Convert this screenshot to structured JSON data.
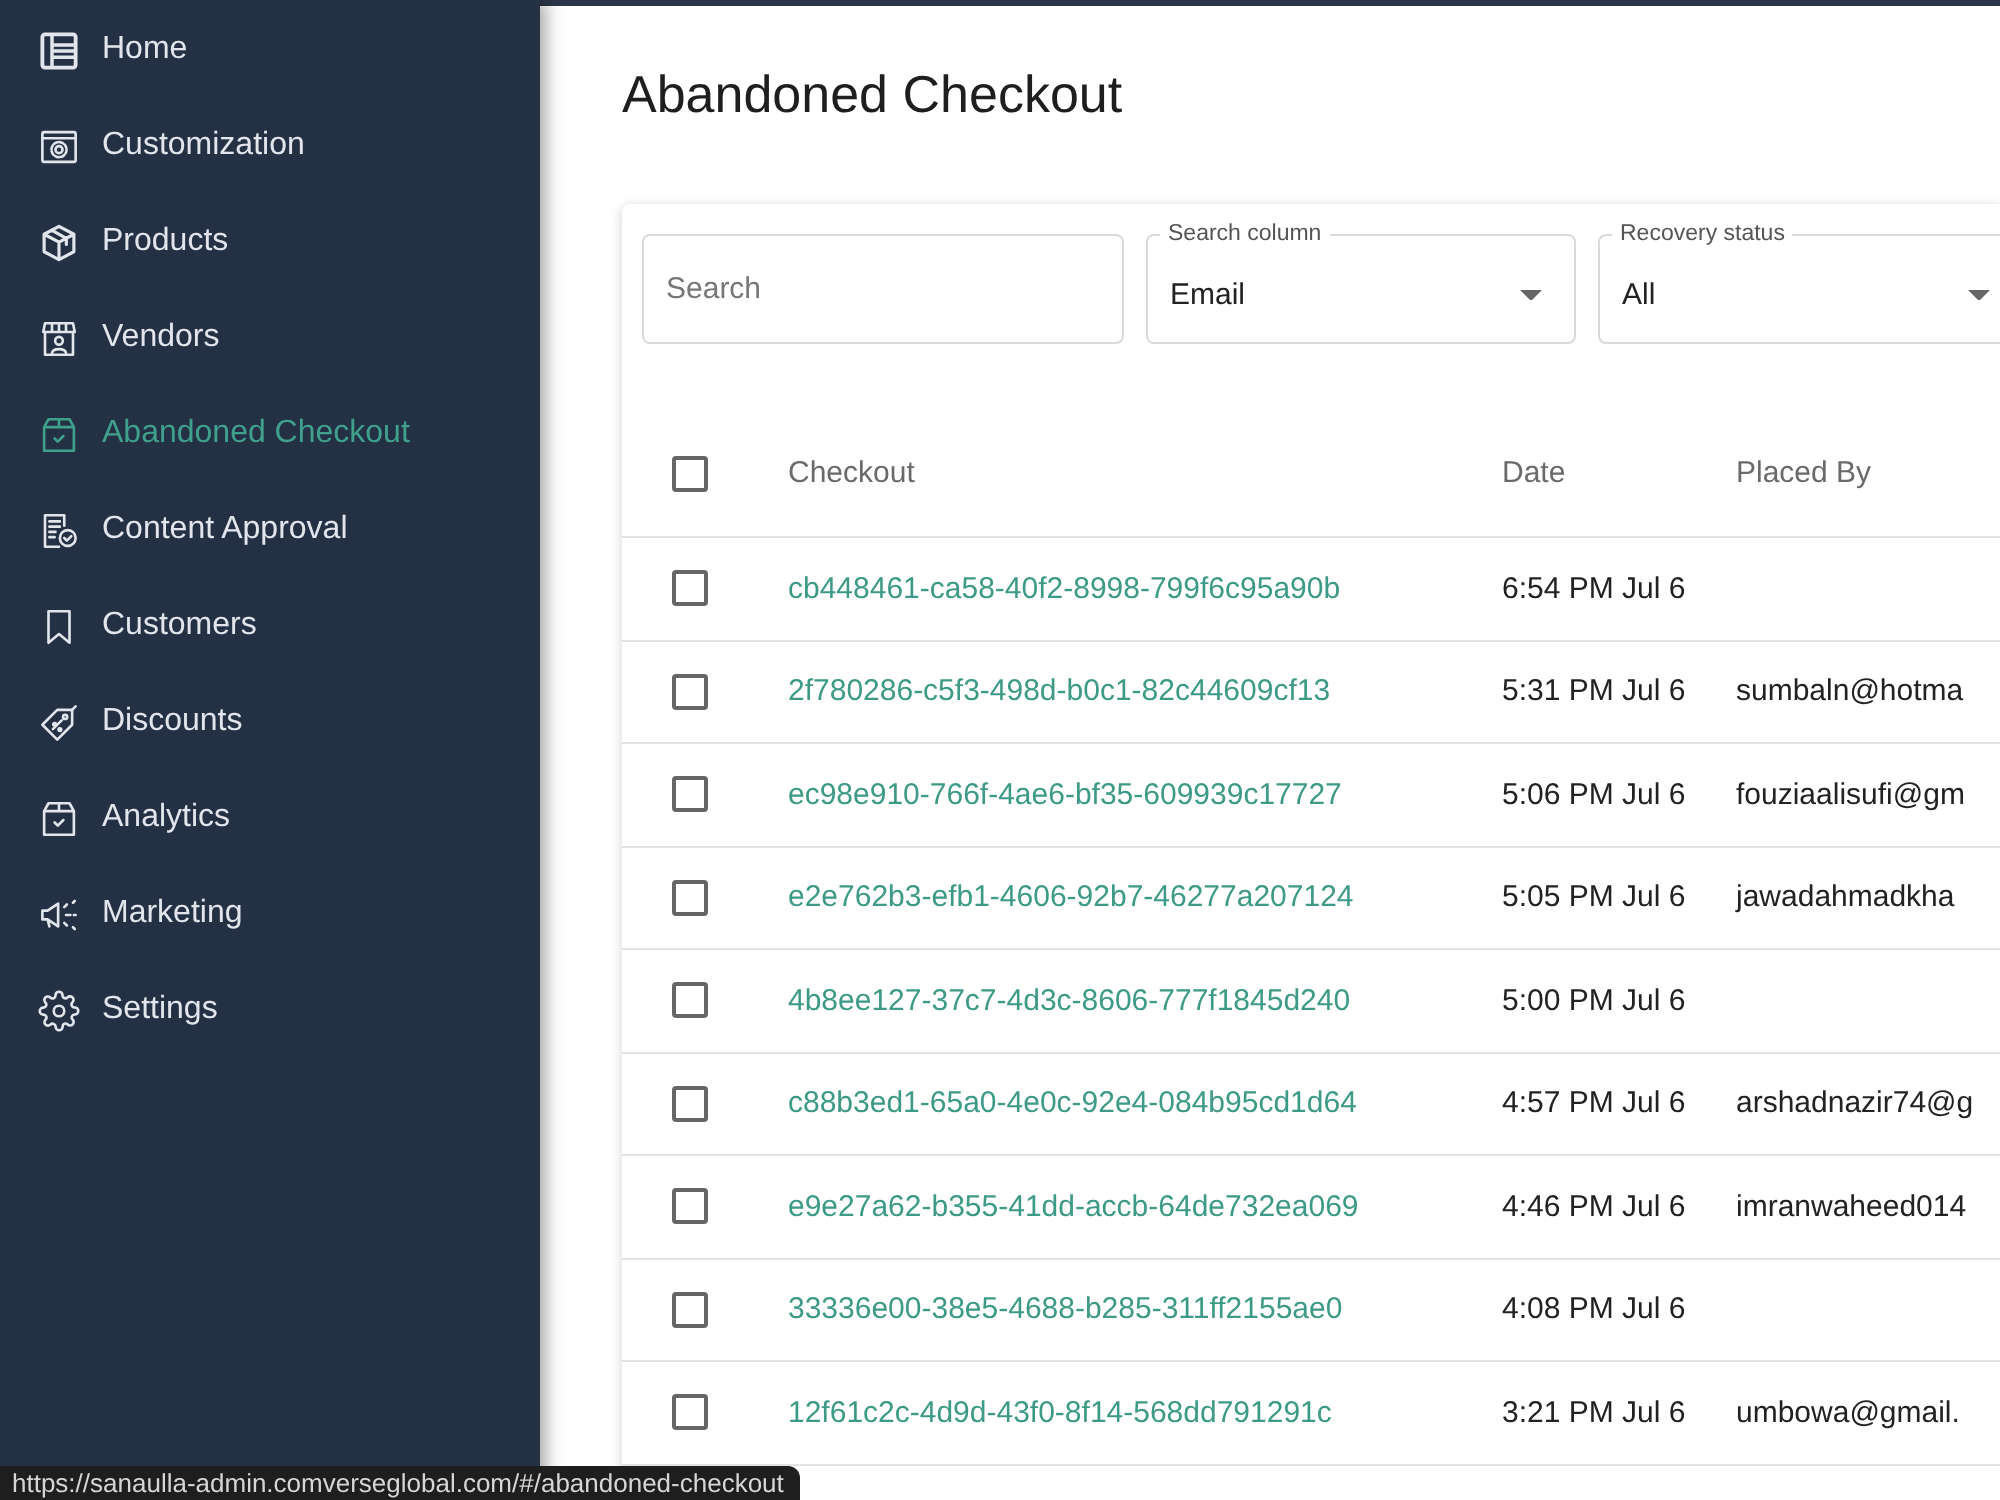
{
  "sidebar": {
    "items": [
      {
        "label": "Home",
        "selected": false
      },
      {
        "label": "Customization",
        "selected": false
      },
      {
        "label": "Products",
        "selected": false
      },
      {
        "label": "Vendors",
        "selected": false
      },
      {
        "label": "Abandoned Checkout",
        "selected": true
      },
      {
        "label": "Content Approval",
        "selected": false
      },
      {
        "label": "Customers",
        "selected": false
      },
      {
        "label": "Discounts",
        "selected": false
      },
      {
        "label": "Analytics",
        "selected": false
      },
      {
        "label": "Marketing",
        "selected": false
      },
      {
        "label": "Settings",
        "selected": false
      }
    ]
  },
  "page": {
    "title": "Abandoned Checkout"
  },
  "filters": {
    "search": {
      "placeholder": "Search"
    },
    "selects": [
      {
        "label": "Search column",
        "value": "Email"
      },
      {
        "label": "Recovery status",
        "value": "All"
      }
    ]
  },
  "table": {
    "header_checkbox": {
      "checked": false
    },
    "columns": [
      "Checkout",
      "Date",
      "Placed By"
    ],
    "rows": [
      {
        "checked": false,
        "checkout": "cb448461-ca58-40f2-8998-799f6c95a90b",
        "date": "6:54 PM Jul 6"
      },
      {
        "checked": false,
        "checkout": "2f780286-c5f3-498d-b0c1-82c44609cf13",
        "date": "5:31 PM Jul 6",
        "placed_by": "sumbaln@hotma"
      },
      {
        "checked": false,
        "checkout": "ec98e910-766f-4ae6-bf35-609939c17727",
        "date": "5:06 PM Jul 6",
        "placed_by": "fouziaalisufi@gm"
      },
      {
        "checked": false,
        "checkout": "e2e762b3-efb1-4606-92b7-46277a207124",
        "date": "5:05 PM Jul 6",
        "placed_by": "jawadahmadkha"
      },
      {
        "checked": false,
        "checkout": "4b8ee127-37c7-4d3c-8606-777f1845d240",
        "date": "5:00 PM Jul 6"
      },
      {
        "checked": false,
        "checkout": "c88b3ed1-65a0-4e0c-92e4-084b95cd1d64",
        "date": "4:57 PM Jul 6",
        "placed_by": "arshadnazir74@g"
      },
      {
        "checked": false,
        "checkout": "e9e27a62-b355-41dd-accb-64de732ea069",
        "date": "4:46 PM Jul 6",
        "placed_by": "imranwaheed014"
      },
      {
        "checked": false,
        "checkout": "33336e00-38e5-4688-b285-311ff2155ae0",
        "date": "4:08 PM Jul 6"
      },
      {
        "checked": false,
        "checkout": "12f61c2c-4d9d-43f0-8f14-568dd791291c",
        "date": "3:21 PM Jul 6",
        "placed_by": "umbowa@gmail."
      }
    ]
  },
  "status_bar": {
    "url": "https://sanaulla-admin.comverseglobal.com/#/abandoned-checkout"
  }
}
